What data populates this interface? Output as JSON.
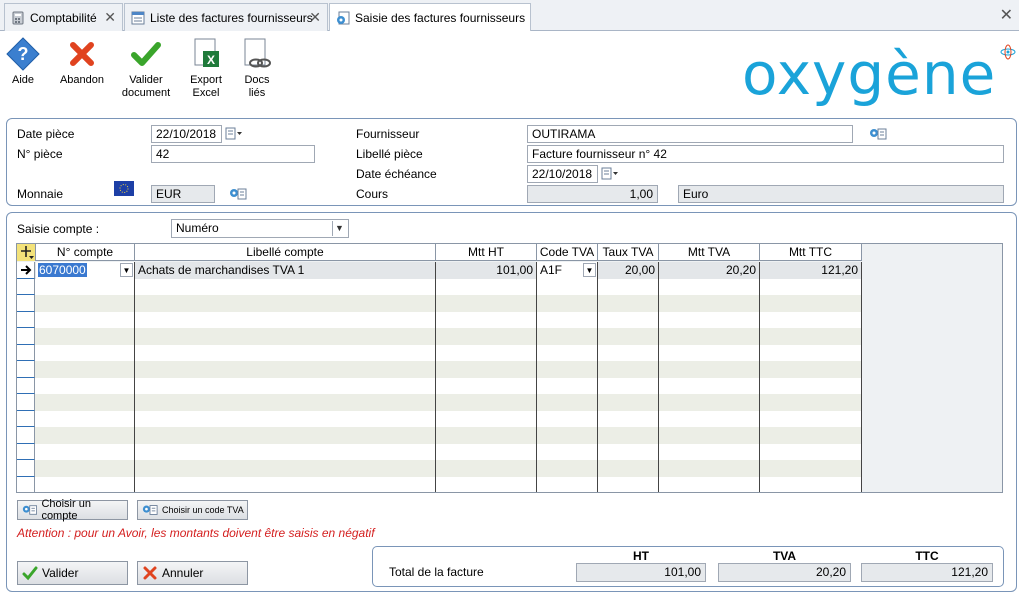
{
  "tabs": [
    {
      "label": "Comptabilité"
    },
    {
      "label": "Liste des factures fournisseurs"
    },
    {
      "label": "Saisie des factures fournisseurs"
    }
  ],
  "toolbar": {
    "help": "Aide",
    "abandon": "Abandon",
    "validate_line1": "Valider",
    "validate_line2": "document",
    "export_line1": "Export",
    "export_line2": "Excel",
    "docs_line1": "Docs",
    "docs_line2": "liés",
    "logo": "oxygène"
  },
  "header": {
    "date_piece_label": "Date pièce",
    "date_piece": "22/10/2018",
    "num_piece_label": "N° pièce",
    "num_piece": "42",
    "monnaie_label": "Monnaie",
    "monnaie": "EUR",
    "fournisseur_label": "Fournisseur",
    "fournisseur": "OUTIRAMA",
    "libelle_label": "Libellé pièce",
    "libelle": "Facture fournisseur n° 42",
    "echeance_label": "Date échéance",
    "echeance": "22/10/2018",
    "cours_label": "Cours",
    "cours": "1,00",
    "devise": "Euro"
  },
  "saisie": {
    "label": "Saisie compte :",
    "mode": "Numéro"
  },
  "grid": {
    "headers": [
      "N° compte",
      "Libellé compte",
      "Mtt HT",
      "Code TVA",
      "Taux TVA",
      "Mtt TVA",
      "Mtt TTC"
    ],
    "rows": [
      {
        "compte": "6070000",
        "libelle": "Achats de marchandises TVA 1",
        "ht": "101,00",
        "code": "A1F",
        "taux": "20,00",
        "tva": "20,20",
        "ttc": "121,20"
      }
    ]
  },
  "buttons": {
    "choose_account": "Choisir un compte",
    "choose_vat": "Choisir un code TVA",
    "validate": "Valider",
    "cancel": "Annuler"
  },
  "warning": "Attention : pour un Avoir, les montants doivent être saisis en négatif",
  "totals": {
    "label": "Total de la facture",
    "ht_label": "HT",
    "tva_label": "TVA",
    "ttc_label": "TTC",
    "ht": "101,00",
    "tva": "20,20",
    "ttc": "121,20"
  }
}
